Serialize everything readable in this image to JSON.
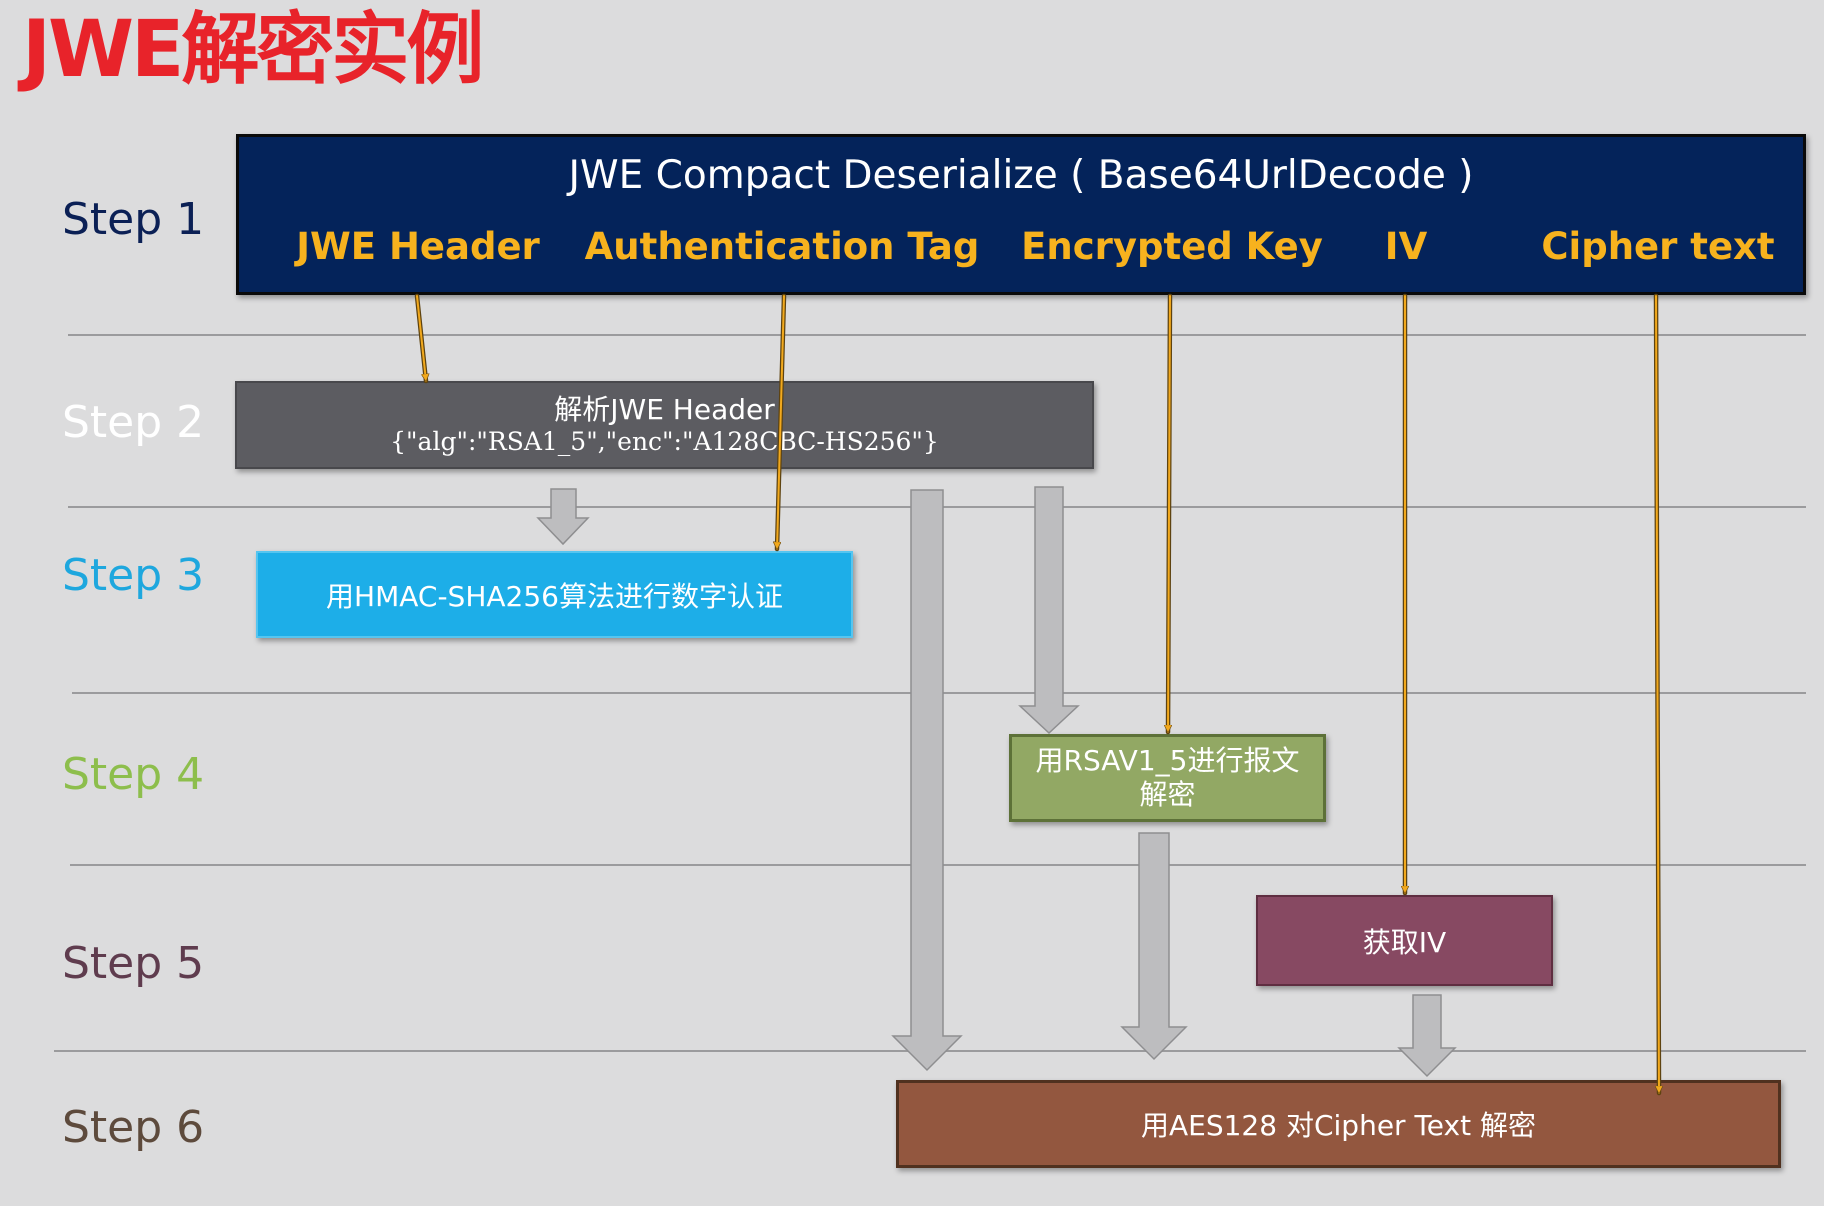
{
  "title": "JWE解密实例",
  "steps": [
    {
      "label": "Step 1",
      "color": "#0b2055"
    },
    {
      "label": "Step 2",
      "color": "#ffffff"
    },
    {
      "label": "Step 3",
      "color": "#1ea7de"
    },
    {
      "label": "Step 4",
      "color": "#8dbe4c"
    },
    {
      "label": "Step 5",
      "color": "#5f3c4e"
    },
    {
      "label": "Step 6",
      "color": "#5d4a3c"
    }
  ],
  "step1": {
    "title": "JWE Compact Deserialize ( Base64UrlDecode )",
    "fields": [
      "JWE Header",
      "Authentication Tag",
      "Encrypted Key",
      "IV",
      "Cipher text"
    ]
  },
  "step2": {
    "line1": "解析JWE Header",
    "line2": "{\"alg\":\"RSA1_5\",\"enc\":\"A128CBC-HS256\"}"
  },
  "step3": {
    "text": "用HMAC-SHA256算法进行数字认证"
  },
  "step4": {
    "line1": "用RSAV1_5进行报文",
    "line2": "解密"
  },
  "step5": {
    "text": "获取IV"
  },
  "step6": {
    "text": "用AES128 对Cipher Text 解密"
  },
  "colors": {
    "background": "#dcdcdd",
    "title": "#e8232a",
    "step1_box": "#04235a",
    "field_text": "#f7b21e",
    "step2_box": "#5c5c61",
    "step3_box": "#1daee8",
    "step4_box": "#92a864",
    "step5_box": "#874962",
    "step6_box": "#93573f",
    "connector": "#f2a91d",
    "block_arrow": "#bdbdbf"
  }
}
